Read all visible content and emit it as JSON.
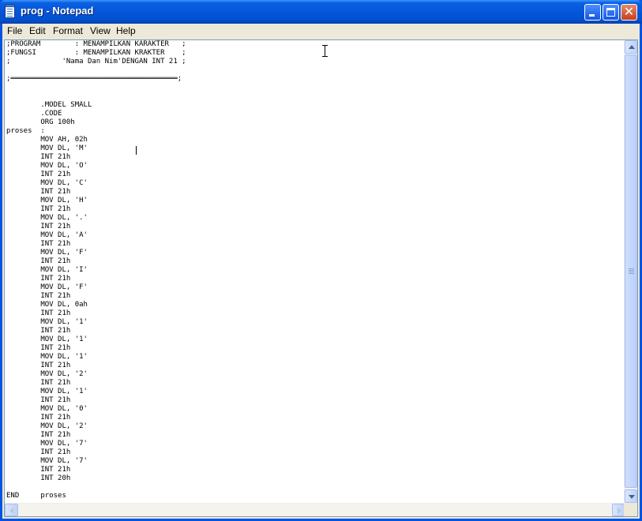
{
  "window": {
    "title": "prog - Notepad",
    "icon": "notepad-icon",
    "controls": {
      "minimize": "minimize-icon",
      "maximize": "maximize-icon",
      "close_glyph": "✕"
    }
  },
  "menu": {
    "file": "File",
    "edit": "Edit",
    "format": "Format",
    "view": "View",
    "help": "Help"
  },
  "editor": {
    "lines": [
      ";PROGRAM        : MENAMPILKAN KARAKTER   ;",
      ";FUNGSI         : MENAMPILKAN KRAKTER    ;",
      ";            'Nama Dan Nim'DENGAN INT 21 ;",
      "",
      ";═══════════════════════════════════════;",
      "",
      "",
      "        .MODEL SMALL",
      "        .CODE",
      "        ORG 100h",
      "proses  :",
      "        MOV AH, 02h",
      "        MOV DL, 'M'",
      "        INT 21h",
      "        MOV DL, 'O'",
      "        INT 21h",
      "        MOV DL, 'C'",
      "        INT 21h",
      "        MOV DL, 'H'",
      "        INT 21h",
      "        MOV DL, '.'",
      "        INT 21h",
      "        MOV DL, 'A'",
      "        INT 21h",
      "        MOV DL, 'F'",
      "        INT 21h",
      "        MOV DL, 'I'",
      "        INT 21h",
      "        MOV DL, 'F'",
      "        INT 21h",
      "        MOV DL, 0ah",
      "        INT 21h",
      "        MOV DL, '1'",
      "        INT 21h",
      "        MOV DL, '1'",
      "        INT 21h",
      "        MOV DL, '1'",
      "        INT 21h",
      "        MOV DL, '2'",
      "        INT 21h",
      "        MOV DL, '1'",
      "        INT 21h",
      "        MOV DL, '0'",
      "        INT 21h",
      "        MOV DL, '2'",
      "        INT 21h",
      "        MOV DL, '7'",
      "        INT 21h",
      "        MOV DL, '7'",
      "        INT 21h",
      "        INT 20h",
      "",
      "END     proses"
    ]
  },
  "colors": {
    "titlebar": "#0054e3",
    "chrome": "#ece9d8",
    "close_button": "#c6401c"
  }
}
